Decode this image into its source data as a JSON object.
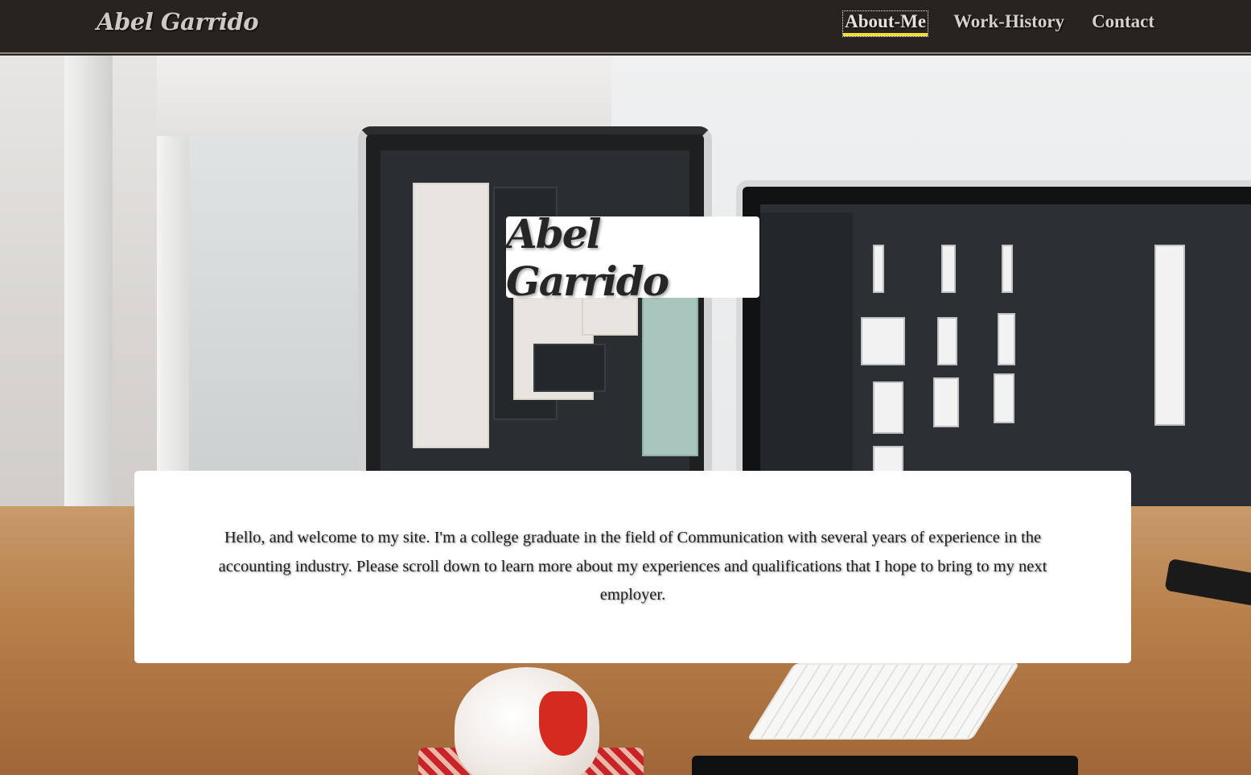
{
  "navbar": {
    "brand": "Abel Garrido",
    "links": [
      {
        "label": "About-Me",
        "active": true
      },
      {
        "label": "Work-History",
        "active": false
      },
      {
        "label": "Contact",
        "active": false
      }
    ]
  },
  "hero": {
    "title": "Abel Garrido",
    "intro": "Hello, and welcome to my site. I'm a college graduate in the field of Communication with several years of experience in the accounting industry. Please scroll down to learn more about my experiences and qualifications that I hope to bring to my next employer."
  },
  "colors": {
    "navbar_bg": "#282321",
    "active_underline": "#f0de3c",
    "card_bg": "#ffffff"
  }
}
